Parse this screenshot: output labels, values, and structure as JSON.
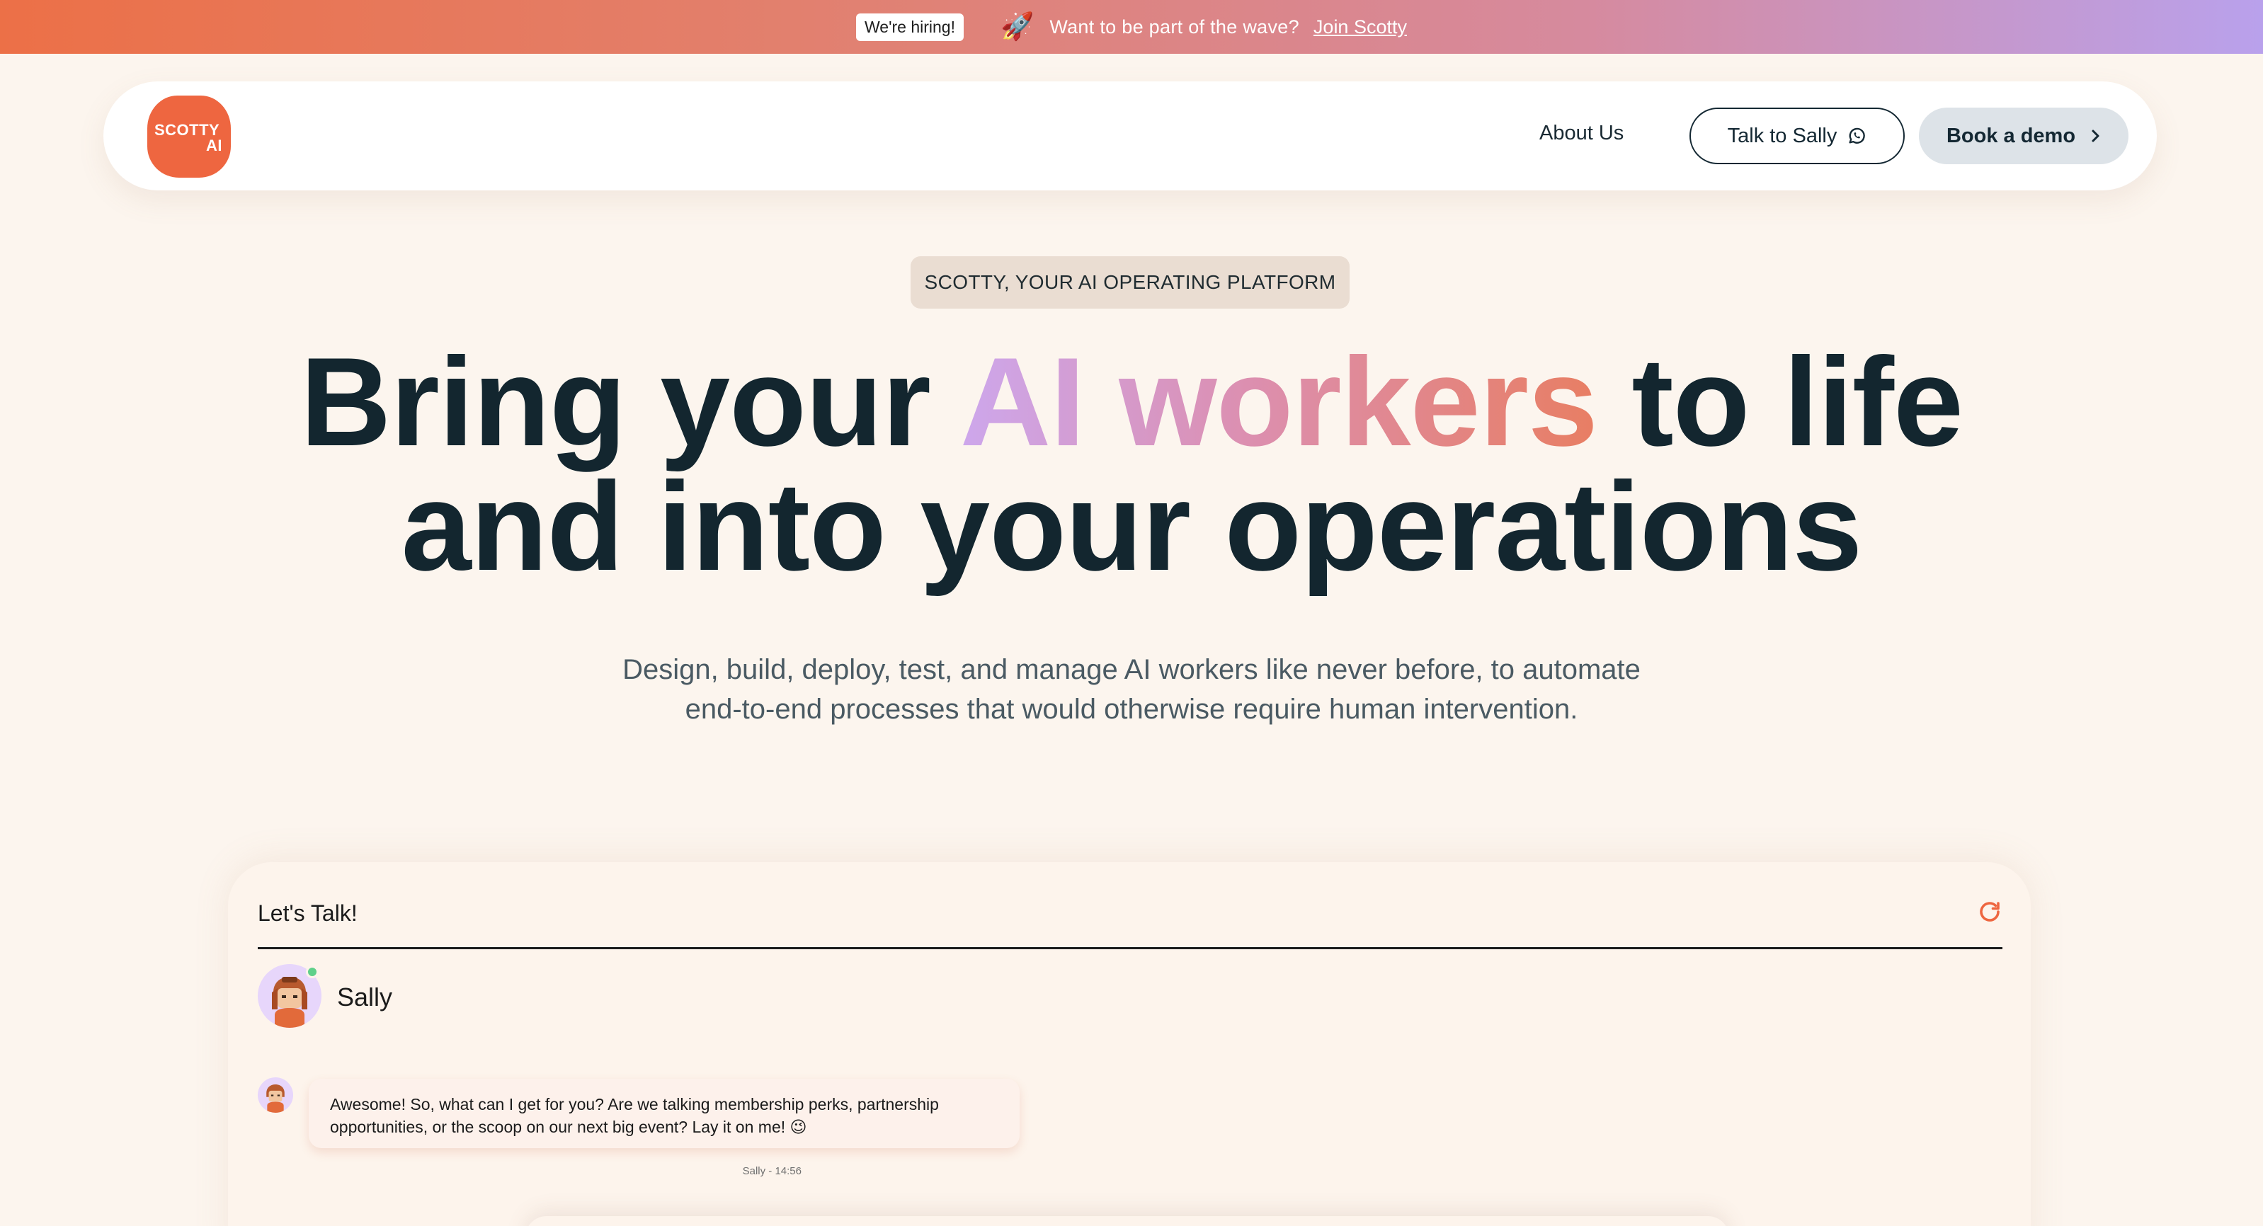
{
  "promo": {
    "badge": "We're hiring!",
    "rocket": "🚀",
    "text": "Want to be part of the wave?",
    "link": "Join Scotty"
  },
  "nav": {
    "logo_line1": "SCOTTY",
    "logo_line2": "AI",
    "about": "About Us",
    "talk_label": "Talk to Sally",
    "demo_label": "Book a demo"
  },
  "hero": {
    "eyebrow": "SCOTTY, YOUR AI OPERATING PLATFORM",
    "title_pre": "Bring your ",
    "title_highlight": "AI workers",
    "title_post": " to life",
    "title_line2": "and into your operations",
    "subtitle_line1": "Design, build, deploy, test, and manage AI workers like never before, to automate",
    "subtitle_line2": "end-to-end processes that would otherwise require human intervention."
  },
  "chat": {
    "title": "Let's Talk!",
    "agent_name": "Sally",
    "messages": [
      {
        "text_line1": "Awesome! So, what can I get for you? Are we talking membership perks, partnership",
        "text_line2": "opportunities, or the scoop on our next big event? Lay it on me! 😉",
        "meta": "Sally - 14:56"
      }
    ]
  },
  "colors": {
    "accent": "#ee6640",
    "text": "#13262f",
    "banner_start": "#ec7047",
    "banner_end": "#b9a1ec",
    "online": "#5fd08a"
  }
}
